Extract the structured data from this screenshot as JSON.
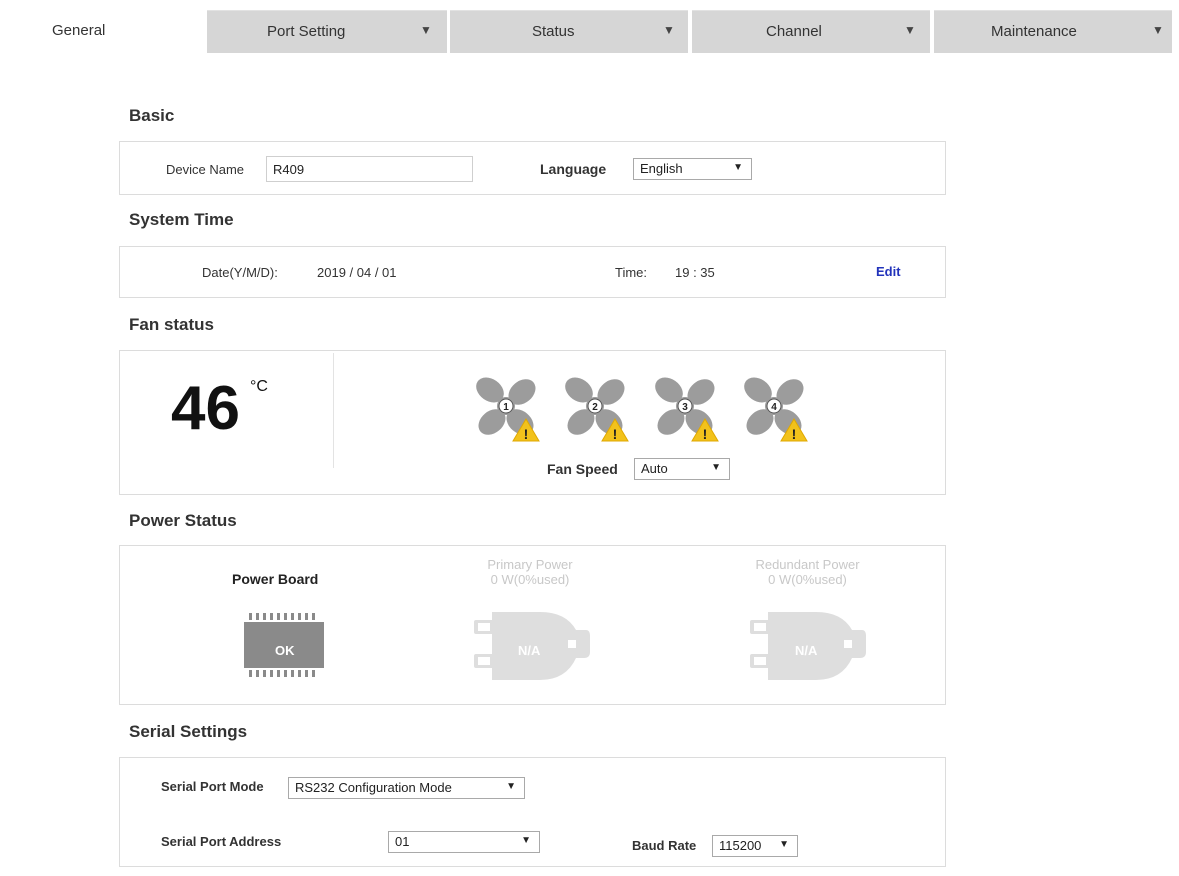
{
  "tabs": [
    {
      "label": "General",
      "active": true
    },
    {
      "label": "Port Setting",
      "arrow": "▼"
    },
    {
      "label": "Status",
      "arrow": "▼"
    },
    {
      "label": "Channel",
      "arrow": "▼"
    },
    {
      "label": "Maintenance",
      "arrow": "▼"
    }
  ],
  "basic": {
    "title": "Basic",
    "device_name_label": "Device Name",
    "device_name_value": "R409",
    "language_label": "Language",
    "language_value": "English"
  },
  "system_time": {
    "title": "System Time",
    "date_label": "Date(Y/M/D):",
    "date_value": "2019 / 04 / 01",
    "time_label": "Time:",
    "time_value": "19 : 35",
    "edit_label": "Edit"
  },
  "fan_status": {
    "title": "Fan status",
    "temperature": "46",
    "unit": "°C",
    "fans": [
      {
        "number": "1",
        "status": "warning"
      },
      {
        "number": "2",
        "status": "warning"
      },
      {
        "number": "3",
        "status": "warning"
      },
      {
        "number": "4",
        "status": "warning"
      }
    ],
    "warning_glyph": "!",
    "fan_speed_label": "Fan Speed",
    "fan_speed_value": "Auto"
  },
  "power_status": {
    "title": "Power Status",
    "power_board_label": "Power Board",
    "power_board_status": "OK",
    "primary_power_label": "Primary Power",
    "primary_power_value": "0 W(0%used)",
    "primary_power_status": "N/A",
    "redundant_power_label": "Redundant Power",
    "redundant_power_value": "0 W(0%used)",
    "redundant_power_status": "N/A"
  },
  "serial_settings": {
    "title": "Serial Settings",
    "mode_label": "Serial Port Mode",
    "mode_value": "RS232 Configuration Mode",
    "address_label": "Serial Port Address",
    "address_value": "01",
    "baud_label": "Baud Rate",
    "baud_value": "115200"
  },
  "colors": {
    "tab_bg": "#d6d6d6",
    "fan_gray": "#9c9c9c",
    "warning_yellow": "#f2c21b",
    "chip_gray": "#8a8a8a",
    "disabled_gray": "#dedede",
    "link_blue": "#2233bb"
  }
}
